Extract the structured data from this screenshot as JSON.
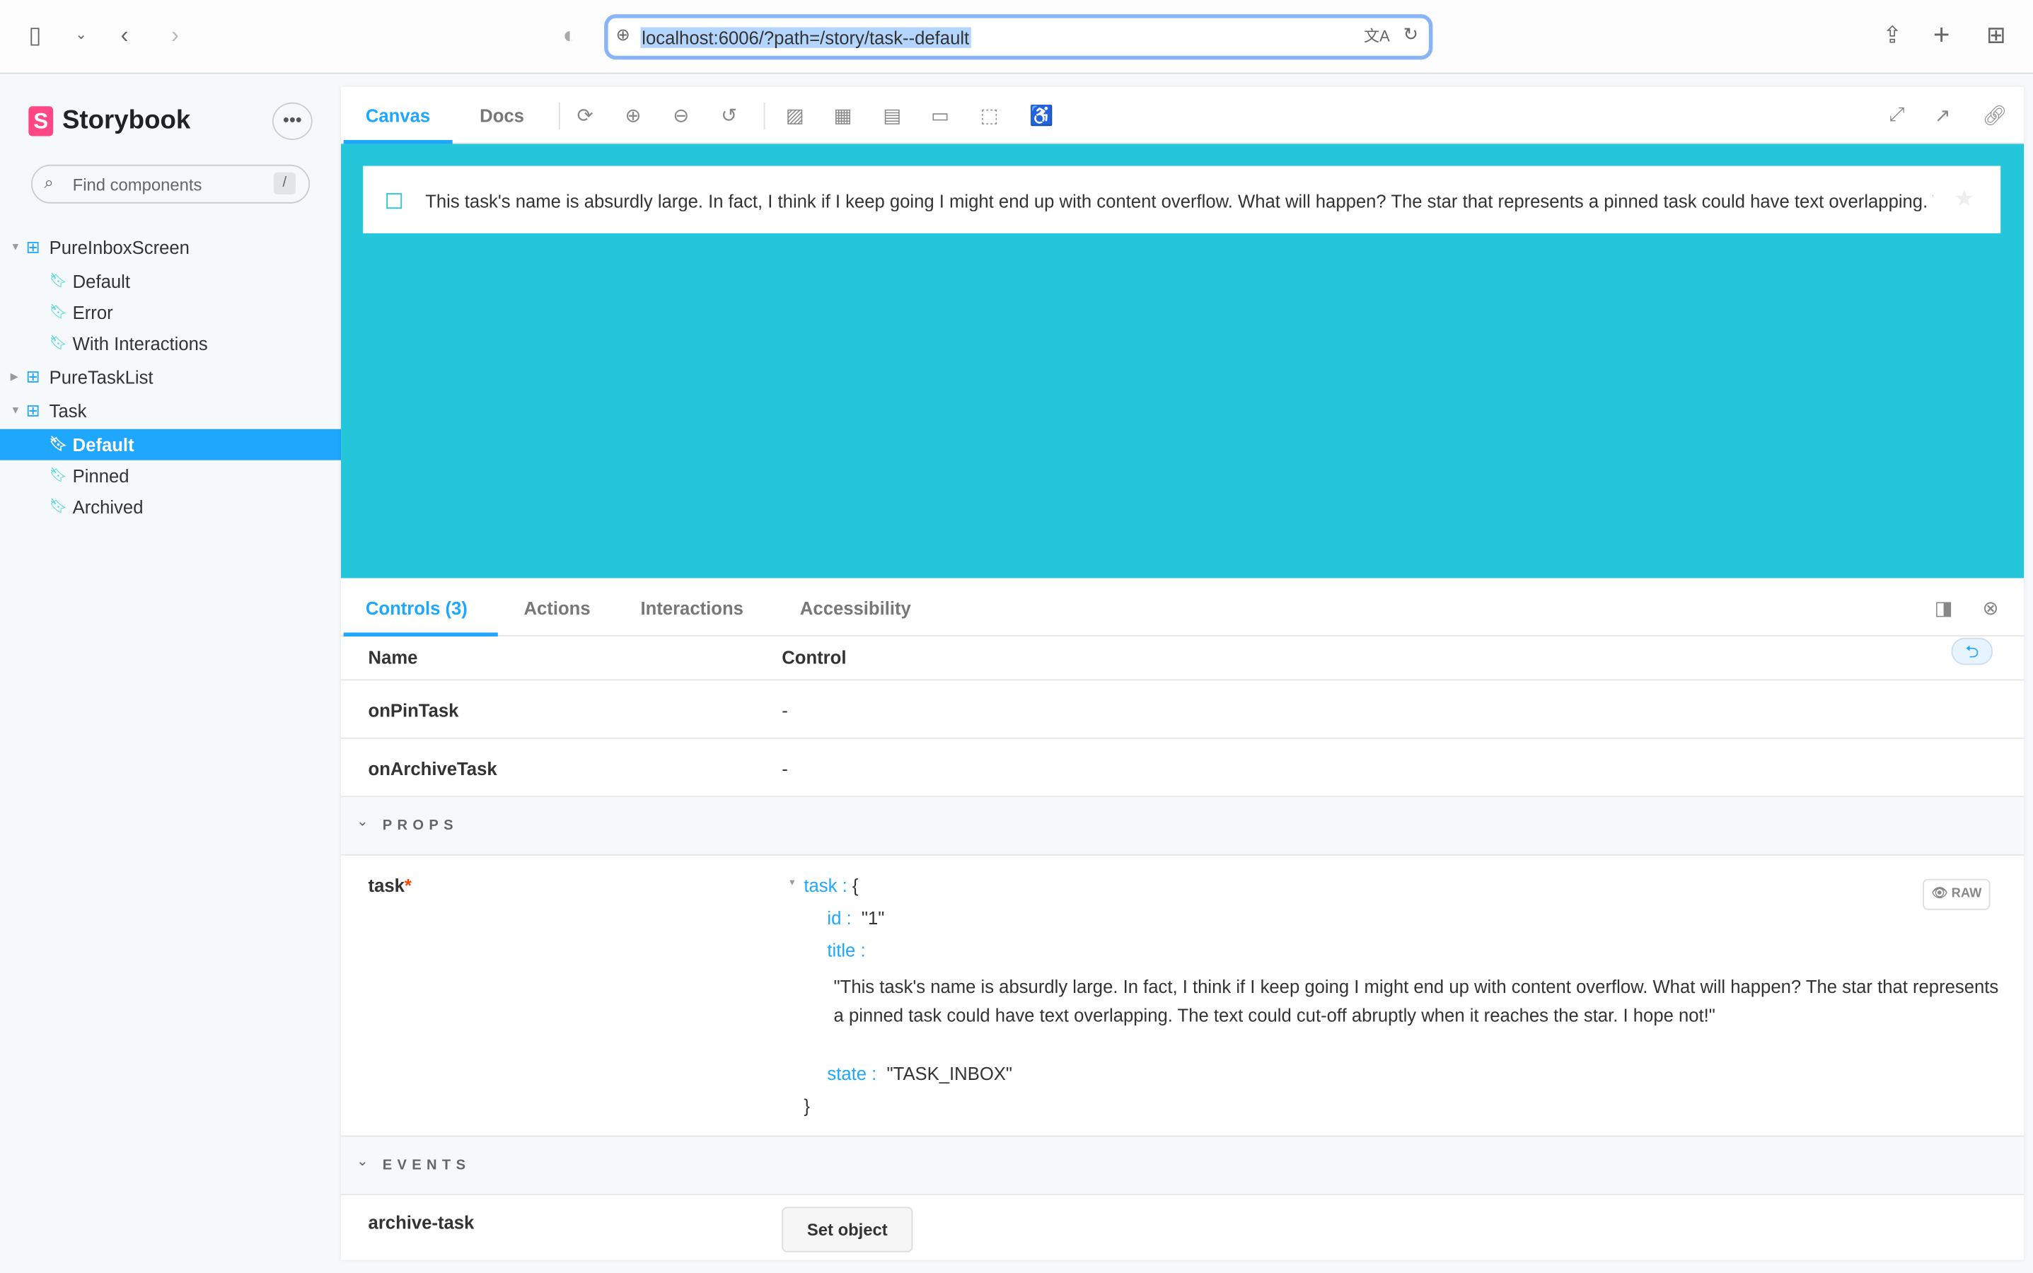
{
  "browser": {
    "url": "localhost:6006/?path=/story/task--default"
  },
  "sidebar": {
    "brand": "Storybook",
    "search_placeholder": "Find components",
    "search_shortcut": "/",
    "items": [
      {
        "label": "PureInboxScreen",
        "type": "component",
        "expanded": true
      },
      {
        "label": "Default",
        "type": "story"
      },
      {
        "label": "Error",
        "type": "story"
      },
      {
        "label": "With Interactions",
        "type": "story"
      },
      {
        "label": "PureTaskList",
        "type": "component",
        "expanded": false
      },
      {
        "label": "Task",
        "type": "component",
        "expanded": true
      },
      {
        "label": "Default",
        "type": "story",
        "selected": true
      },
      {
        "label": "Pinned",
        "type": "story"
      },
      {
        "label": "Archived",
        "type": "story"
      }
    ]
  },
  "toolbar": {
    "tabs": [
      "Canvas",
      "Docs"
    ],
    "active": "Canvas"
  },
  "canvas": {
    "background": "#26c6da",
    "task_title": "This task's name is absurdly large. In fact, I think if I keep going I might end up with content overflow. What will happen? The star that represents a pinned task could have text overlapping. The text could cut-off abruptly when it reaches the star. I hope not!"
  },
  "addons": {
    "tabs": [
      "Controls (3)",
      "Actions",
      "Interactions",
      "Accessibility"
    ],
    "active": "Controls (3)"
  },
  "controls": {
    "header_name": "Name",
    "header_control": "Control",
    "rows": [
      {
        "name": "onPinTask",
        "control": "-"
      },
      {
        "name": "onArchiveTask",
        "control": "-"
      }
    ],
    "props_label": "PROPS",
    "task_name": "task",
    "required_mark": "*",
    "json": {
      "root": "task :",
      "open": "{",
      "id_key": "id :",
      "id_val": "\"1\"",
      "title_key": "title :",
      "title_val": "\"This task's name is absurdly large. In fact, I think if I keep going I might end up with content overflow. What will happen? The star that represents a pinned task could have text overlapping. The text could cut-off abruptly when it reaches the star. I hope not!\"",
      "state_key": "state :",
      "state_val": "\"TASK_INBOX\"",
      "close": "}"
    },
    "raw_label": "RAW",
    "events_label": "EVENTS",
    "event_name": "archive-task",
    "set_object": "Set object"
  },
  "colors": {
    "accent": "#1ea7fd",
    "brand": "#ff4785"
  }
}
